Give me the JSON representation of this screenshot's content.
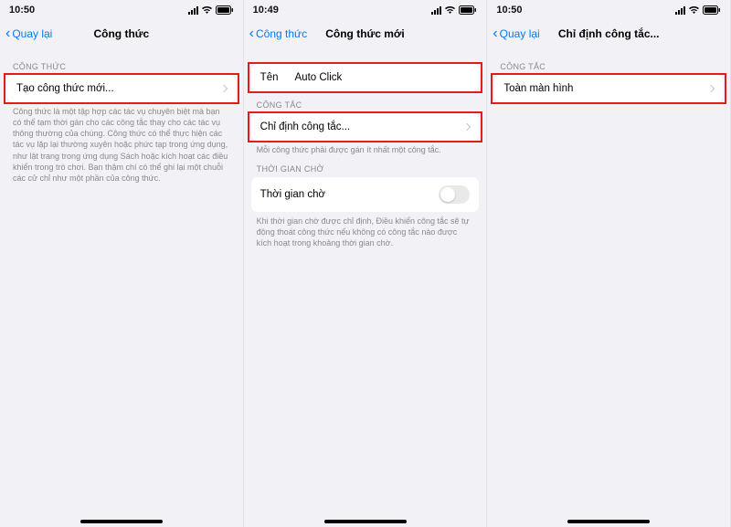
{
  "status": {
    "time1": "10:50",
    "time2": "10:49",
    "time3": "10:50"
  },
  "screen1": {
    "back": "Quay lại",
    "title": "Công thức",
    "section": "CÔNG THỨC",
    "row": "Tạo công thức mới...",
    "footer": "Công thức là một tập hợp các tác vụ chuyên biệt mà bạn có thể tạm thời gán cho các công tắc thay cho các tác vụ thông thường của chúng. Công thức có thể thực hiện các tác vụ lặp lại thường xuyên hoặc phức tạp trong ứng dụng, như lật trang trong ứng dụng Sách hoặc kích hoạt các điều khiển trong trò chơi. Bạn thậm chí có thể ghi lại một chuỗi các cử chỉ như một phần của công thức."
  },
  "screen2": {
    "back": "Công thức",
    "title": "Công thức mới",
    "name_key": "Tên",
    "name_val": "Auto Click",
    "sec_congtac": "CÔNG TẮC",
    "row_assign": "Chỉ định công tắc...",
    "footer_assign": "Mỗi công thức phải được gán ít nhất một công tắc.",
    "sec_wait": "THỜI GIAN CHỜ",
    "row_wait": "Thời gian chờ",
    "footer_wait": "Khi thời gian chờ được chỉ định, Điều khiển công tắc sẽ tự động thoát công thức nếu không có công tắc nào được kích hoạt trong khoảng thời gian chờ."
  },
  "screen3": {
    "back": "Quay lại",
    "title": "Chỉ định công tắc...",
    "section": "CÔNG TẮC",
    "row": "Toàn màn hình"
  }
}
